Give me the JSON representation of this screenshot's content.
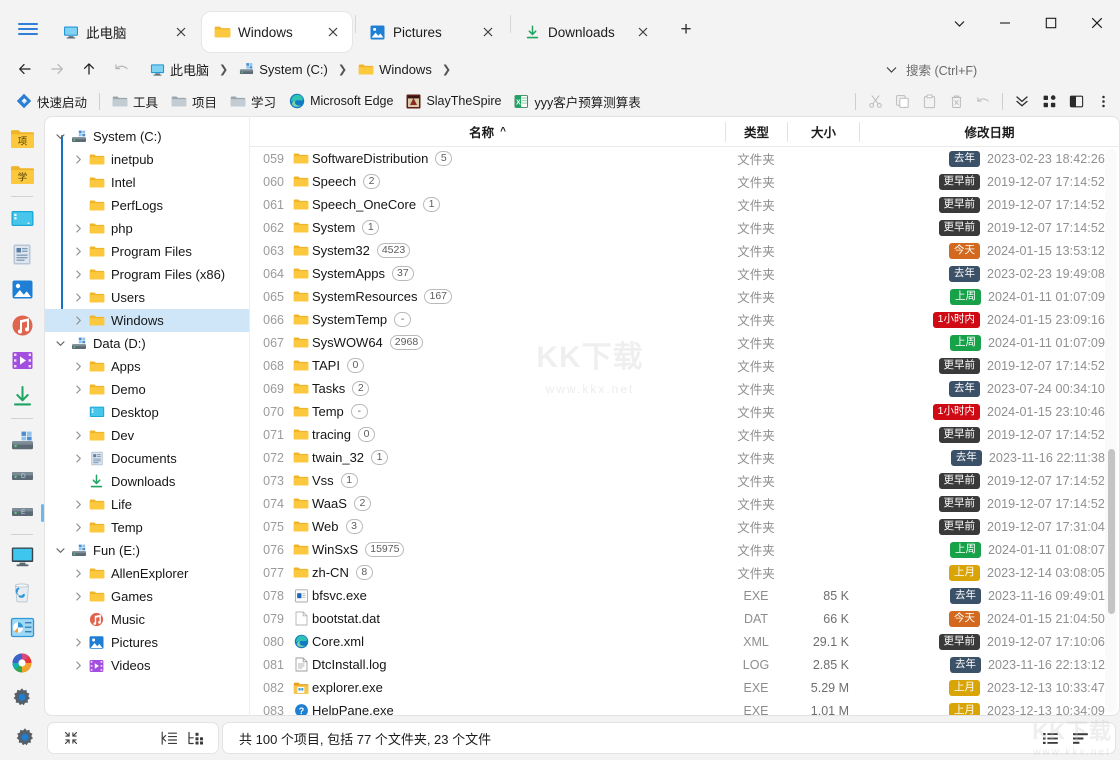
{
  "window": {
    "controls": {
      "chevron": "window-chevron",
      "minimize": "–",
      "maximize": "□",
      "close": "✕"
    }
  },
  "tabs": [
    {
      "label": "此电脑",
      "icon": "pc-icon",
      "active": false
    },
    {
      "label": "Windows",
      "icon": "folder-icon",
      "active": true
    },
    {
      "label": "Pictures",
      "icon": "pictures-icon",
      "active": false
    },
    {
      "label": "Downloads",
      "icon": "downloads-icon",
      "active": false
    }
  ],
  "newtab_label": "+",
  "nav": {
    "back": "back-icon",
    "forward": "forward-icon",
    "up": "up-icon",
    "undo": "undo-icon",
    "breadcrumbs": [
      {
        "label": "此电脑",
        "icon": "pc-icon"
      },
      {
        "label": "System (C:)",
        "icon": "drive-icon"
      },
      {
        "label": "Windows",
        "icon": "folder-icon"
      }
    ],
    "search": {
      "placeholder": "搜索 (Ctrl+F)"
    }
  },
  "bookmarks": {
    "quick_launch": "快速启动",
    "items": [
      {
        "label": "工具",
        "icon": "folder-icon"
      },
      {
        "label": "项目",
        "icon": "folder-icon"
      },
      {
        "label": "学习",
        "icon": "folder-icon"
      },
      {
        "label": "Microsoft Edge",
        "icon": "edge-icon"
      },
      {
        "label": "SlayTheSpire",
        "icon": "app-icon"
      },
      {
        "label": "yyy客户预算测算表",
        "icon": "excel-icon"
      }
    ],
    "tools": [
      "cut-icon",
      "copy-icon",
      "paste-icon",
      "delete-icon",
      "undo-icon",
      "chevrons-down-icon",
      "layout-icon",
      "panel-icon",
      "more-icon"
    ]
  },
  "rail": [
    {
      "icon": "folder-xiang-icon",
      "label": "项"
    },
    {
      "icon": "folder-xue-icon",
      "label": "学"
    },
    {
      "icon": "divider",
      "label": ""
    },
    {
      "icon": "desktop-icon",
      "label": ""
    },
    {
      "icon": "documents-icon",
      "label": ""
    },
    {
      "icon": "pictures-icon",
      "label": ""
    },
    {
      "icon": "music-icon",
      "label": ""
    },
    {
      "icon": "videos-icon",
      "label": ""
    },
    {
      "icon": "downloads-icon",
      "label": ""
    },
    {
      "icon": "divider",
      "label": ""
    },
    {
      "icon": "drive-c-icon",
      "label": ""
    },
    {
      "icon": "drive-d-icon",
      "label": ""
    },
    {
      "icon": "drive-e-icon",
      "label": ""
    },
    {
      "icon": "divider",
      "label": ""
    },
    {
      "icon": "this-pc-icon",
      "label": ""
    },
    {
      "icon": "recycle-bin-icon",
      "label": ""
    },
    {
      "icon": "control-panel-icon",
      "label": ""
    },
    {
      "icon": "colorwheel-icon",
      "label": ""
    },
    {
      "icon": "settings-gear-icon",
      "label": ""
    }
  ],
  "tree": [
    {
      "label": "System (C:)",
      "icon": "drive-icon",
      "indent": 0,
      "twisty": "down",
      "selected": false
    },
    {
      "label": "inetpub",
      "icon": "folder-icon",
      "indent": 1,
      "twisty": "right",
      "selected": false
    },
    {
      "label": "Intel",
      "icon": "folder-icon",
      "indent": 1,
      "twisty": "",
      "selected": false
    },
    {
      "label": "PerfLogs",
      "icon": "folder-icon",
      "indent": 1,
      "twisty": "",
      "selected": false
    },
    {
      "label": "php",
      "icon": "folder-icon",
      "indent": 1,
      "twisty": "right",
      "selected": false
    },
    {
      "label": "Program Files",
      "icon": "folder-icon",
      "indent": 1,
      "twisty": "right",
      "selected": false
    },
    {
      "label": "Program Files (x86)",
      "icon": "folder-icon",
      "indent": 1,
      "twisty": "right",
      "selected": false
    },
    {
      "label": "Users",
      "icon": "folder-icon",
      "indent": 1,
      "twisty": "right",
      "selected": false
    },
    {
      "label": "Windows",
      "icon": "folder-icon",
      "indent": 1,
      "twisty": "right",
      "selected": true
    },
    {
      "label": "Data (D:)",
      "icon": "drive-icon",
      "indent": 0,
      "twisty": "down",
      "selected": false
    },
    {
      "label": "Apps",
      "icon": "folder-icon",
      "indent": 1,
      "twisty": "right",
      "selected": false
    },
    {
      "label": "Demo",
      "icon": "folder-icon",
      "indent": 1,
      "twisty": "right",
      "selected": false
    },
    {
      "label": "Desktop",
      "icon": "desktop-icon",
      "indent": 1,
      "twisty": "",
      "selected": false
    },
    {
      "label": "Dev",
      "icon": "folder-icon",
      "indent": 1,
      "twisty": "right",
      "selected": false
    },
    {
      "label": "Documents",
      "icon": "documents-icon",
      "indent": 1,
      "twisty": "right",
      "selected": false
    },
    {
      "label": "Downloads",
      "icon": "downloads-icon",
      "indent": 1,
      "twisty": "",
      "selected": false
    },
    {
      "label": "Life",
      "icon": "folder-icon",
      "indent": 1,
      "twisty": "right",
      "selected": false
    },
    {
      "label": "Temp",
      "icon": "folder-icon",
      "indent": 1,
      "twisty": "right",
      "selected": false
    },
    {
      "label": "Fun (E:)",
      "icon": "drive-icon",
      "indent": 0,
      "twisty": "down",
      "selected": false
    },
    {
      "label": "AllenExplorer",
      "icon": "folder-icon",
      "indent": 1,
      "twisty": "right",
      "selected": false
    },
    {
      "label": "Games",
      "icon": "folder-icon",
      "indent": 1,
      "twisty": "right",
      "selected": false
    },
    {
      "label": "Music",
      "icon": "music-icon",
      "indent": 1,
      "twisty": "",
      "selected": false
    },
    {
      "label": "Pictures",
      "icon": "pictures-icon",
      "indent": 1,
      "twisty": "right",
      "selected": false
    },
    {
      "label": "Videos",
      "icon": "videos-icon",
      "indent": 1,
      "twisty": "right",
      "selected": false
    }
  ],
  "columns": {
    "name": "名称",
    "sort_arrow": "^",
    "type": "类型",
    "size": "大小",
    "date": "修改日期"
  },
  "rows": [
    {
      "idx": "059",
      "icon": "folder-icon",
      "name": "SoftwareDistribution",
      "count": "5",
      "type": "文件夹",
      "size": "",
      "badge": "去年",
      "badge_color": "#3b5168",
      "date": "2023-02-23  18:42:26"
    },
    {
      "idx": "060",
      "icon": "folder-icon",
      "name": "Speech",
      "count": "2",
      "type": "文件夹",
      "size": "",
      "badge": "更早前",
      "badge_color": "#3a3a3a",
      "date": "2019-12-07  17:14:52"
    },
    {
      "idx": "061",
      "icon": "folder-icon",
      "name": "Speech_OneCore",
      "count": "1",
      "type": "文件夹",
      "size": "",
      "badge": "更早前",
      "badge_color": "#3a3a3a",
      "date": "2019-12-07  17:14:52"
    },
    {
      "idx": "062",
      "icon": "folder-icon",
      "name": "System",
      "count": "1",
      "type": "文件夹",
      "size": "",
      "badge": "更早前",
      "badge_color": "#3a3a3a",
      "date": "2019-12-07  17:14:52"
    },
    {
      "idx": "063",
      "icon": "folder-icon",
      "name": "System32",
      "count": "4523",
      "type": "文件夹",
      "size": "",
      "badge": "今天",
      "badge_color": "#d2691e",
      "date": "2024-01-15  13:53:12"
    },
    {
      "idx": "064",
      "icon": "folder-icon",
      "name": "SystemApps",
      "count": "37",
      "type": "文件夹",
      "size": "",
      "badge": "去年",
      "badge_color": "#3b5168",
      "date": "2023-02-23  19:49:08"
    },
    {
      "idx": "065",
      "icon": "folder-icon",
      "name": "SystemResources",
      "count": "167",
      "type": "文件夹",
      "size": "",
      "badge": "上周",
      "badge_color": "#17a24a",
      "date": "2024-01-11  01:07:09"
    },
    {
      "idx": "066",
      "icon": "folder-icon",
      "name": "SystemTemp",
      "count": "-",
      "type": "文件夹",
      "size": "",
      "badge": "1小时内",
      "badge_color": "#cf0a14",
      "date": "2024-01-15  23:09:16"
    },
    {
      "idx": "067",
      "icon": "folder-icon",
      "name": "SysWOW64",
      "count": "2968",
      "type": "文件夹",
      "size": "",
      "badge": "上周",
      "badge_color": "#17a24a",
      "date": "2024-01-11  01:07:09"
    },
    {
      "idx": "068",
      "icon": "folder-icon",
      "name": "TAPI",
      "count": "0",
      "type": "文件夹",
      "size": "",
      "badge": "更早前",
      "badge_color": "#3a3a3a",
      "date": "2019-12-07  17:14:52"
    },
    {
      "idx": "069",
      "icon": "folder-icon",
      "name": "Tasks",
      "count": "2",
      "type": "文件夹",
      "size": "",
      "badge": "去年",
      "badge_color": "#3b5168",
      "date": "2023-07-24  00:34:10"
    },
    {
      "idx": "070",
      "icon": "folder-icon",
      "name": "Temp",
      "count": "-",
      "type": "文件夹",
      "size": "",
      "badge": "1小时内",
      "badge_color": "#cf0a14",
      "date": "2024-01-15  23:10:46"
    },
    {
      "idx": "071",
      "icon": "folder-icon",
      "name": "tracing",
      "count": "0",
      "type": "文件夹",
      "size": "",
      "badge": "更早前",
      "badge_color": "#3a3a3a",
      "date": "2019-12-07  17:14:52"
    },
    {
      "idx": "072",
      "icon": "folder-icon",
      "name": "twain_32",
      "count": "1",
      "type": "文件夹",
      "size": "",
      "badge": "去年",
      "badge_color": "#3b5168",
      "date": "2023-11-16  22:11:38"
    },
    {
      "idx": "073",
      "icon": "folder-icon",
      "name": "Vss",
      "count": "1",
      "type": "文件夹",
      "size": "",
      "badge": "更早前",
      "badge_color": "#3a3a3a",
      "date": "2019-12-07  17:14:52"
    },
    {
      "idx": "074",
      "icon": "folder-icon",
      "name": "WaaS",
      "count": "2",
      "type": "文件夹",
      "size": "",
      "badge": "更早前",
      "badge_color": "#3a3a3a",
      "date": "2019-12-07  17:14:52"
    },
    {
      "idx": "075",
      "icon": "folder-icon",
      "name": "Web",
      "count": "3",
      "type": "文件夹",
      "size": "",
      "badge": "更早前",
      "badge_color": "#3a3a3a",
      "date": "2019-12-07  17:31:04"
    },
    {
      "idx": "076",
      "icon": "folder-icon",
      "name": "WinSxS",
      "count": "15975",
      "type": "文件夹",
      "size": "",
      "badge": "上周",
      "badge_color": "#17a24a",
      "date": "2024-01-11  01:08:07"
    },
    {
      "idx": "077",
      "icon": "folder-icon",
      "name": "zh-CN",
      "count": "8",
      "type": "文件夹",
      "size": "",
      "badge": "上月",
      "badge_color": "#d9a406",
      "date": "2023-12-14  03:08:05"
    },
    {
      "idx": "078",
      "icon": "exe-icon",
      "name": "bfsvc.exe",
      "count": "",
      "type": "EXE",
      "size": "85 K",
      "badge": "去年",
      "badge_color": "#3b5168",
      "date": "2023-11-16  09:49:01"
    },
    {
      "idx": "079",
      "icon": "file-icon",
      "name": "bootstat.dat",
      "count": "",
      "type": "DAT",
      "size": "66 K",
      "badge": "今天",
      "badge_color": "#d2691e",
      "date": "2024-01-15  21:04:50"
    },
    {
      "idx": "080",
      "icon": "edge-icon",
      "name": "Core.xml",
      "count": "",
      "type": "XML",
      "size": "29.1 K",
      "badge": "更早前",
      "badge_color": "#3a3a3a",
      "date": "2019-12-07  17:10:06"
    },
    {
      "idx": "081",
      "icon": "log-icon",
      "name": "DtcInstall.log",
      "count": "",
      "type": "LOG",
      "size": "2.85 K",
      "badge": "去年",
      "badge_color": "#3b5168",
      "date": "2023-11-16  22:13:12"
    },
    {
      "idx": "082",
      "icon": "explorer-icon",
      "name": "explorer.exe",
      "count": "",
      "type": "EXE",
      "size": "5.29 M",
      "badge": "上月",
      "badge_color": "#d9a406",
      "date": "2023-12-13  10:33:47"
    },
    {
      "idx": "083",
      "icon": "help-icon",
      "name": "HelpPane.exe",
      "count": "",
      "type": "EXE",
      "size": "1.01 M",
      "badge": "上月",
      "badge_color": "#d9a406",
      "date": "2023-12-13  10:34:09"
    }
  ],
  "watermark": {
    "title": "KK下载",
    "sub": "www.kkx.net"
  },
  "status": {
    "summary": "共 100 个项目, 包括 77 个文件夹, 23 个文件",
    "gear": "settings-gear-icon",
    "collapse": "collapse-icon",
    "indent": "indent-icon",
    "tree_toggle": "tree-toggle-icon",
    "view_list": "list-view-icon",
    "view_details": "details-view-icon"
  }
}
